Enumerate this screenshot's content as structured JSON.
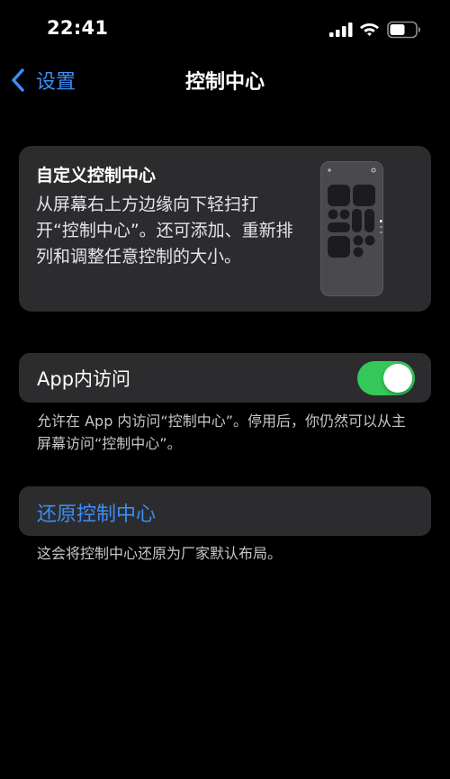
{
  "status_bar": {
    "time": "22:41"
  },
  "nav": {
    "back_label": "设置",
    "title": "控制中心"
  },
  "info_card": {
    "title": "自定义控制中心",
    "description": "从屏幕右上方边缘向下轻扫打开“控制中心”。还可添加、重新排列和调整任意控制的大小。"
  },
  "app_access": {
    "label": "App内访问",
    "enabled": true,
    "footnote": "允许在 App 内访问“控制中心”。停用后，你仍然可以从主屏幕访问“控制中心”。"
  },
  "reset": {
    "label": "还原控制中心",
    "footnote": "这会将控制中心还原为厂家默认布局。"
  },
  "colors": {
    "accent": "#3a8ef6",
    "toggle_on": "#34c759",
    "cell_background": "#2c2c2e",
    "background": "#000000"
  },
  "icons": {
    "signal": "cellular-signal-icon",
    "wifi": "wifi-icon",
    "battery": "battery-icon",
    "back": "chevron-left-icon"
  }
}
